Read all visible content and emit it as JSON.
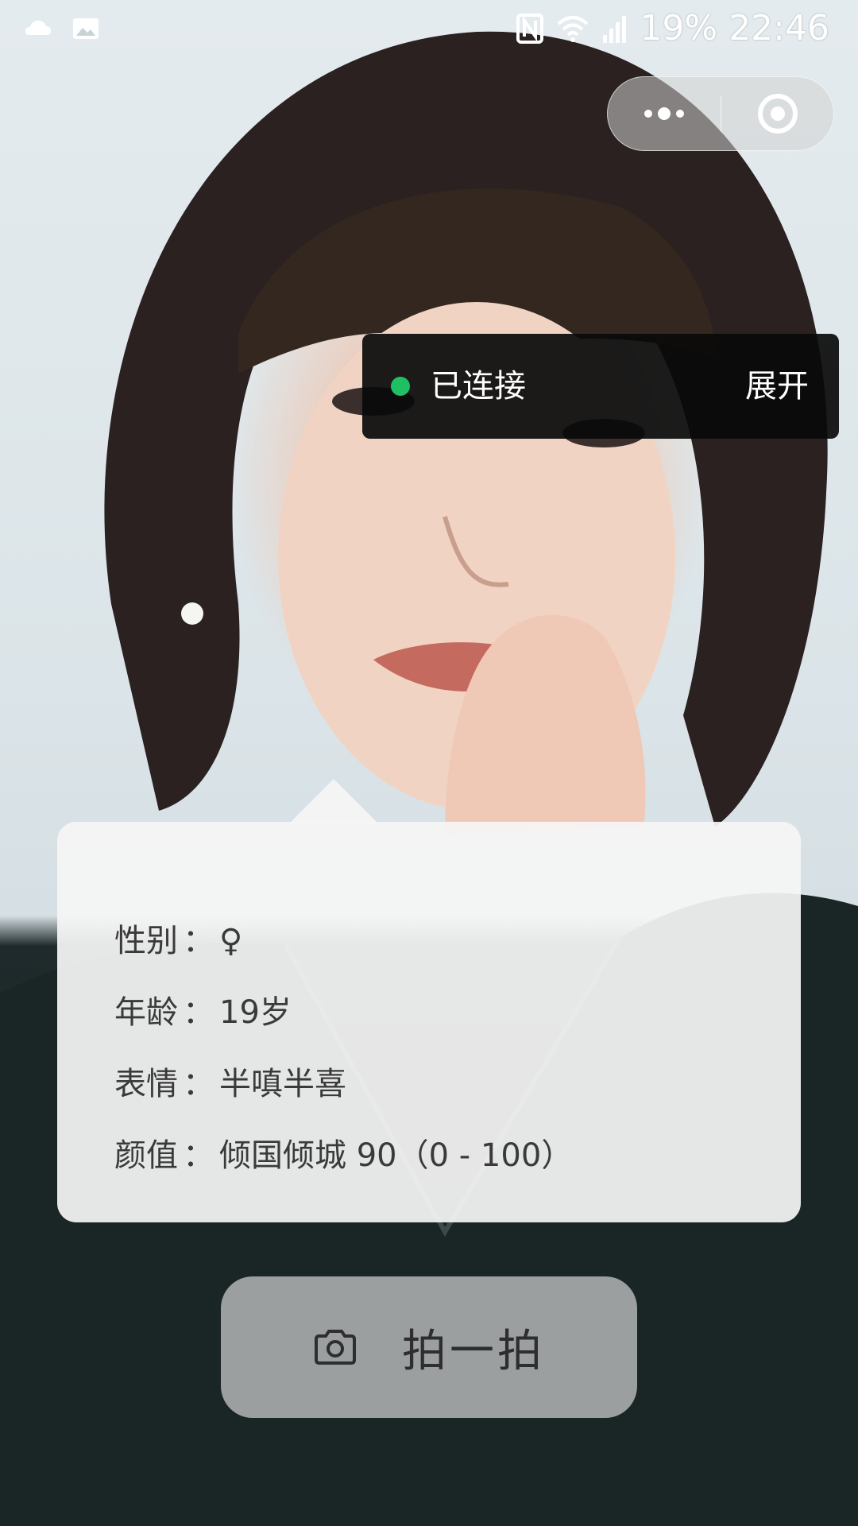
{
  "status_bar": {
    "left_icons": [
      "cloud-icon",
      "image-icon"
    ],
    "right_icons": [
      "nfc-icon",
      "wifi-icon",
      "signal-icon"
    ],
    "battery_text": "19%",
    "time": "22:46"
  },
  "capsule": {
    "more_icon": "more-dots-icon",
    "close_icon": "target-circle-icon"
  },
  "connection": {
    "status_color": "#1fc063",
    "status_text": "已连接",
    "expand_label": "展开"
  },
  "result": {
    "gender_label": "性别",
    "gender_value": "♀",
    "age_label": "年龄",
    "age_value": "19岁",
    "expression_label": "表情",
    "expression_value": "半嗔半喜",
    "beauty_label": "颜值",
    "beauty_value": "倾国倾城 90（0 - 100）"
  },
  "shoot_button": {
    "icon": "camera-icon",
    "label": "拍一拍"
  }
}
